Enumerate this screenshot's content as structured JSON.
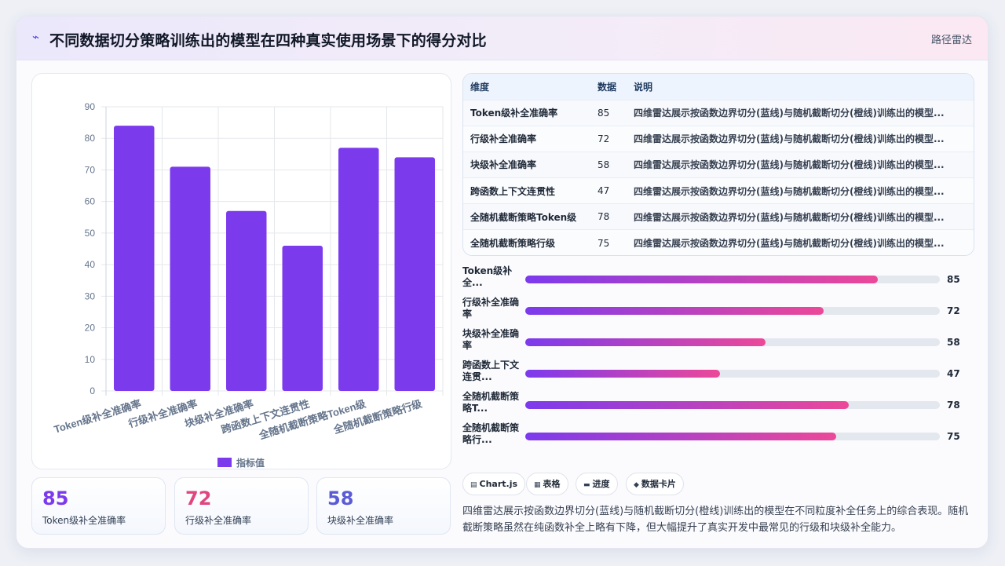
{
  "header": {
    "title": "不同数据切分策略训练出的模型在四种真实使用场景下的得分对比",
    "tag": "路径雷达",
    "logo_icon": "⌁"
  },
  "chart_data": {
    "type": "bar",
    "categories": [
      "Token级补全准确率",
      "行级补全准确率",
      "块级补全准确率",
      "跨函数上下文连贯性",
      "全随机截断策略Token级",
      "全随机截断策略行级"
    ],
    "series": [
      {
        "name": "指标值",
        "values": [
          84,
          71,
          57,
          46,
          77,
          74
        ]
      }
    ],
    "ylim": [
      0,
      90
    ],
    "yticks": [
      0,
      10,
      20,
      30,
      40,
      50,
      60,
      70,
      80,
      90
    ],
    "bar_color": "#7c3aed",
    "grid": true,
    "legend": "bottom"
  },
  "stats": [
    {
      "value": "85",
      "label": "Token级补全准确率",
      "color": "#7c3aed"
    },
    {
      "value": "72",
      "label": "行级补全准确率",
      "color": "#e0457f"
    },
    {
      "value": "58",
      "label": "块级补全准确率",
      "color": "#5b5bd6"
    }
  ],
  "table": {
    "headers": [
      "维度",
      "数据",
      "说明"
    ],
    "rows": [
      [
        "Token级补全准确率",
        "85",
        "四维雷达展示按函数边界切分(蓝线)与随机截断切分(橙线)训练出的模型..."
      ],
      [
        "行级补全准确率",
        "72",
        "四维雷达展示按函数边界切分(蓝线)与随机截断切分(橙线)训练出的模型..."
      ],
      [
        "块级补全准确率",
        "58",
        "四维雷达展示按函数边界切分(蓝线)与随机截断切分(橙线)训练出的模型..."
      ],
      [
        "跨函数上下文连贯性",
        "47",
        "四维雷达展示按函数边界切分(蓝线)与随机截断切分(橙线)训练出的模型..."
      ],
      [
        "全随机截断策略Token级",
        "78",
        "四维雷达展示按函数边界切分(蓝线)与随机截断切分(橙线)训练出的模型..."
      ],
      [
        "全随机截断策略行级",
        "75",
        "四维雷达展示按函数边界切分(蓝线)与随机截断切分(橙线)训练出的模型..."
      ]
    ]
  },
  "progress": [
    {
      "label": "Token级补全...",
      "value": 85
    },
    {
      "label": "行级补全准确率",
      "value": 72
    },
    {
      "label": "块级补全准确率",
      "value": 58
    },
    {
      "label": "跨函数上下文连贯...",
      "value": 47
    },
    {
      "label": "全随机截断策略T...",
      "value": 78
    },
    {
      "label": "全随机截断策略行...",
      "value": 75
    }
  ],
  "chips": [
    {
      "icon": "▤",
      "label": "Chart.js"
    },
    {
      "icon": "▦",
      "label": "表格"
    },
    {
      "icon": "▬",
      "label": "进度"
    },
    {
      "icon": "◆",
      "label": "数据卡片"
    }
  ],
  "description": "四维雷达展示按函数边界切分(蓝线)与随机截断切分(橙线)训练出的模型在不同粒度补全任务上的综合表现。随机截断策略虽然在纯函数补全上略有下降，但大幅提升了真实开发中最常见的行级和块级补全能力。"
}
